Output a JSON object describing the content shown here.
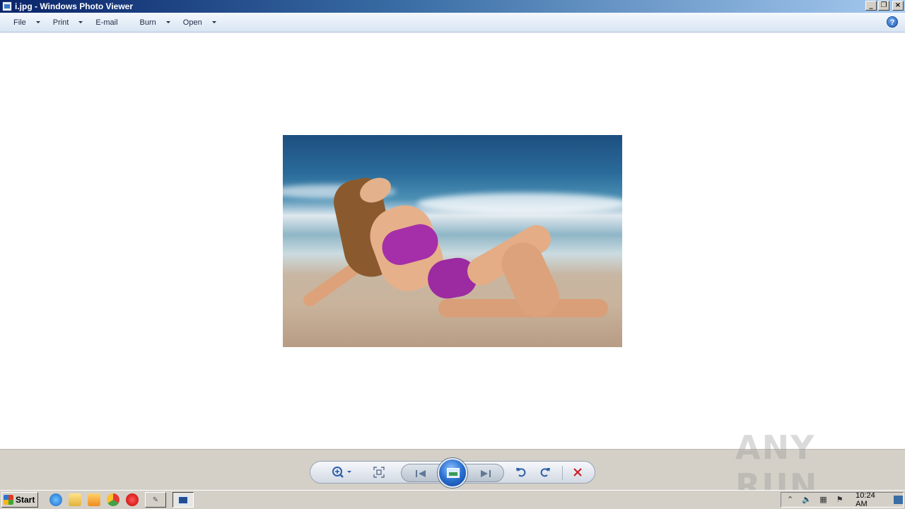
{
  "window": {
    "title": "i.jpg - Windows Photo Viewer"
  },
  "menubar": {
    "items": [
      {
        "label": "File",
        "has_dropdown": true
      },
      {
        "label": "Print",
        "has_dropdown": true
      },
      {
        "label": "E-mail",
        "has_dropdown": false
      },
      {
        "label": "Burn",
        "has_dropdown": true
      },
      {
        "label": "Open",
        "has_dropdown": true
      }
    ],
    "help_label": "?"
  },
  "toolbar": {
    "zoom_icon": "zoom-icon",
    "actual_size_icon": "fit-icon",
    "previous_icon": "previous-icon",
    "slideshow_icon": "slideshow-icon",
    "next_icon": "next-icon",
    "rotate_ccw_icon": "rotate-counterclockwise-icon",
    "rotate_cw_icon": "rotate-clockwise-icon",
    "delete_icon": "delete-icon"
  },
  "watermark": {
    "text": "ANY RUN"
  },
  "taskbar": {
    "start_label": "Start",
    "clock": "10:24 AM"
  }
}
